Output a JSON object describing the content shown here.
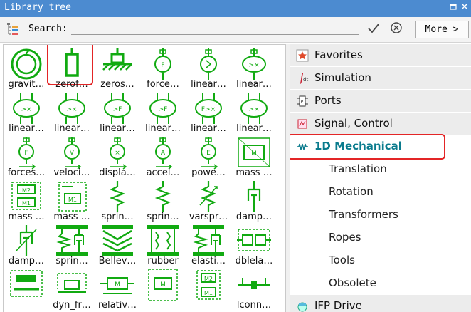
{
  "window": {
    "title": "Library tree"
  },
  "icons": {
    "float": "float-icon",
    "close": "close-icon",
    "tree": "tree-icon",
    "accept": "checkmark-icon",
    "clear": "clear-icon"
  },
  "search": {
    "label": "Search:",
    "value": "",
    "more": "More >"
  },
  "colors": {
    "titlebar": "#4c8bd0",
    "symbol": "#11aa11",
    "highlight": "#e32526",
    "active_text": "#0a7b8d"
  },
  "library": {
    "items": [
      {
        "label": "gravit…"
      },
      {
        "label": "zerof…"
      },
      {
        "label": "zeros…"
      },
      {
        "label": "force…"
      },
      {
        "label": "linear…"
      },
      {
        "label": "linear…"
      },
      {
        "label": "linear…"
      },
      {
        "label": "linear…"
      },
      {
        "label": "linear…"
      },
      {
        "label": "linear…"
      },
      {
        "label": "linear…"
      },
      {
        "label": "linear…"
      },
      {
        "label": "forces…"
      },
      {
        "label": "veloci…"
      },
      {
        "label": "displa…"
      },
      {
        "label": "accel…"
      },
      {
        "label": "powe…"
      },
      {
        "label": "mass …"
      },
      {
        "label": "mass …"
      },
      {
        "label": "mass …"
      },
      {
        "label": "sprin…"
      },
      {
        "label": "sprin…"
      },
      {
        "label": "varspr…"
      },
      {
        "label": "damp…"
      },
      {
        "label": "damp…"
      },
      {
        "label": "sprin…"
      },
      {
        "label": "Bellev…"
      },
      {
        "label": "rubber"
      },
      {
        "label": "elasti…"
      },
      {
        "label": "dblela…"
      },
      {
        "label": ""
      },
      {
        "label": "dyn_fr…"
      },
      {
        "label": "relativ…"
      },
      {
        "label": ""
      },
      {
        "label": ""
      },
      {
        "label": "lconn…"
      }
    ]
  },
  "tree": {
    "items": [
      {
        "label": "Favorites",
        "icon": "star-icon"
      },
      {
        "label": "Simulation",
        "icon": "integral-icon"
      },
      {
        "label": "Ports",
        "icon": "ports-icon"
      },
      {
        "label": "Signal, Control",
        "icon": "signal-icon"
      },
      {
        "label": "1D Mechanical",
        "icon": "mechanical-icon"
      },
      {
        "label": "Translation"
      },
      {
        "label": "Rotation"
      },
      {
        "label": "Transformers"
      },
      {
        "label": "Ropes"
      },
      {
        "label": "Tools"
      },
      {
        "label": "Obsolete"
      },
      {
        "label": "IFP Drive",
        "icon": "drive-icon"
      }
    ]
  }
}
